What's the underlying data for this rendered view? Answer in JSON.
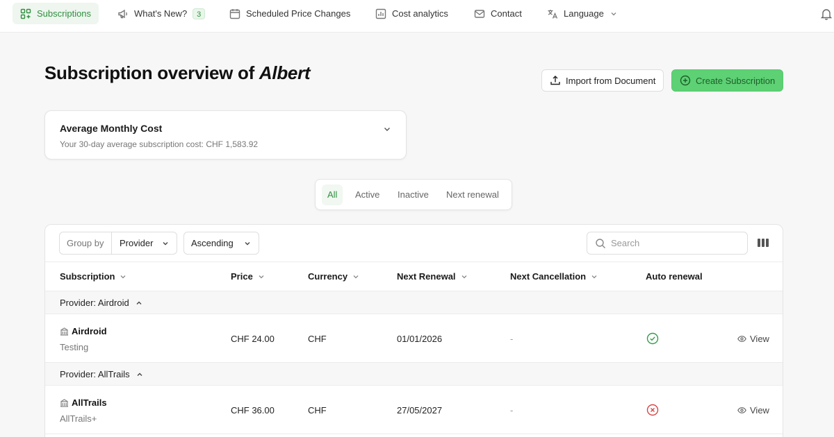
{
  "nav": {
    "items": [
      {
        "label": "Subscriptions",
        "icon": "subscriptions-grid-icon",
        "active": true
      },
      {
        "label": "What's New?",
        "icon": "megaphone-icon",
        "badge": "3"
      },
      {
        "label": "Scheduled Price Changes",
        "icon": "calendar-icon"
      },
      {
        "label": "Cost analytics",
        "icon": "bar-chart-icon"
      },
      {
        "label": "Contact",
        "icon": "mail-icon"
      },
      {
        "label": "Language",
        "icon": "translate-icon"
      }
    ],
    "notifications_icon": "bell-icon"
  },
  "header": {
    "title_prefix": "Subscription overview of",
    "user_name": "Albert",
    "import_label": "Import from Document",
    "create_label": "Create Subscription"
  },
  "cost_card": {
    "title": "Average Monthly Cost",
    "subtitle": "Your 30-day average subscription cost: CHF 1,583.92"
  },
  "filters": {
    "tabs": [
      "All",
      "Active",
      "Inactive",
      "Next renewal"
    ],
    "active": "All"
  },
  "table": {
    "group_by_label": "Group by",
    "group_by_value": "Provider",
    "order_value": "Ascending",
    "search_placeholder": "Search",
    "columns": [
      "Subscription",
      "Price",
      "Currency",
      "Next Renewal",
      "Next Cancellation",
      "Auto renewal"
    ],
    "groups": [
      {
        "label": "Provider: Airdroid",
        "rows": [
          {
            "name": "Airdroid",
            "plan": "Testing",
            "price": "CHF 24.00",
            "currency": "CHF",
            "next_renewal": "01/01/2026",
            "next_cancellation": "-",
            "auto_renewal": true,
            "action": "View"
          }
        ]
      },
      {
        "label": "Provider: AllTrails",
        "rows": [
          {
            "name": "AllTrails",
            "plan": "AllTrails+",
            "price": "CHF 36.00",
            "currency": "CHF",
            "next_renewal": "27/05/2027",
            "next_cancellation": "-",
            "auto_renewal": false,
            "action": "View"
          }
        ]
      }
    ]
  },
  "colors": {
    "accent_green": "#2f8f3f",
    "create_button_bg": "#5dd174",
    "auto_renewal_on": "#2f9e44",
    "auto_renewal_off": "#d64545"
  }
}
